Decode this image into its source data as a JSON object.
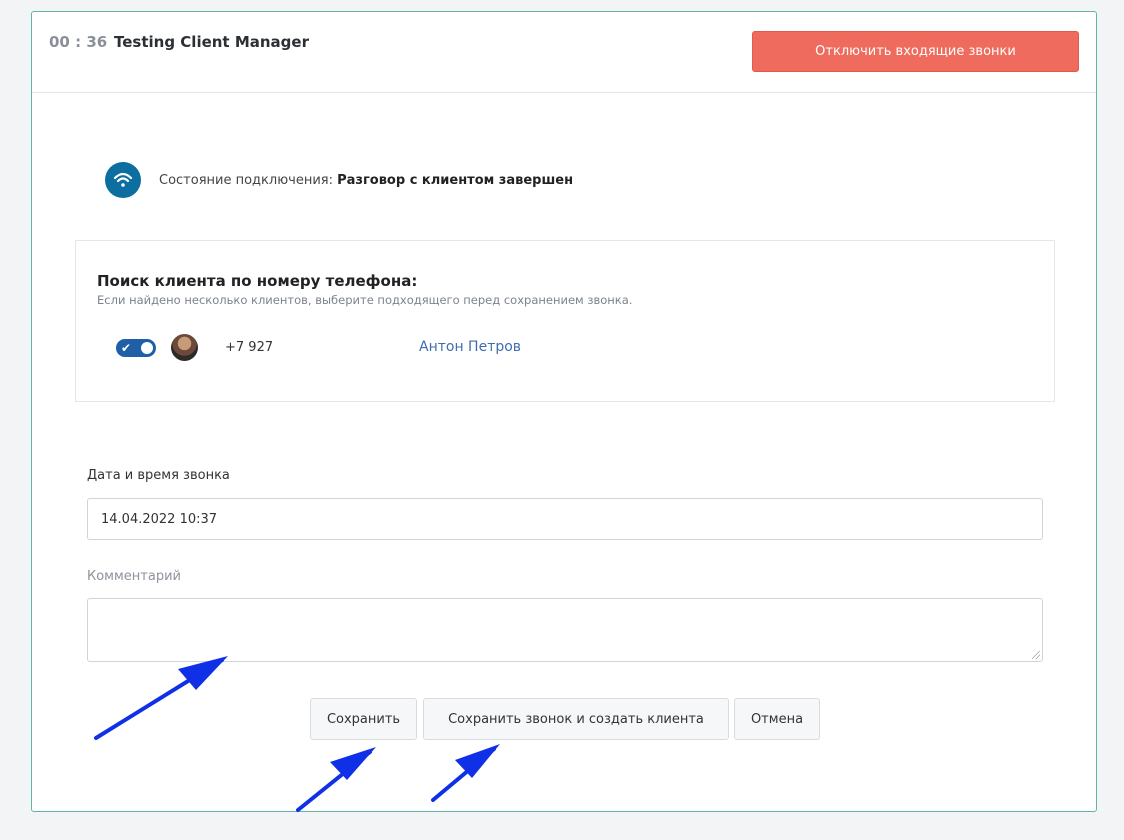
{
  "header": {
    "timer": "00 : 36",
    "title": "Testing Client Manager",
    "disable_button": "Отключить входящие звонки"
  },
  "status": {
    "icon": "wifi-icon",
    "label": "Состояние подключения:",
    "value": "Разговор с клиентом завершен"
  },
  "search": {
    "title": "Поиск клиента по номеру телефона:",
    "hint": "Если найдено несколько клиентов, выберите подходящего перед сохранением звонка.",
    "client": {
      "selected": true,
      "phone": "+7 927",
      "name": "Антон Петров"
    }
  },
  "form": {
    "date_label": "Дата и время звонка",
    "date_value": "14.04.2022 10:37",
    "comment_label": "Комментарий",
    "comment_value": ""
  },
  "buttons": {
    "save": "Сохранить",
    "save_create": "Сохранить звонок и создать клиента",
    "cancel": "Отмена"
  },
  "colors": {
    "accent_border": "#5fb3a8",
    "danger": "#ee6b5d",
    "status_icon": "#0d6fa0",
    "link": "#3f6eb0",
    "annotation_arrow": "#1030e8"
  }
}
